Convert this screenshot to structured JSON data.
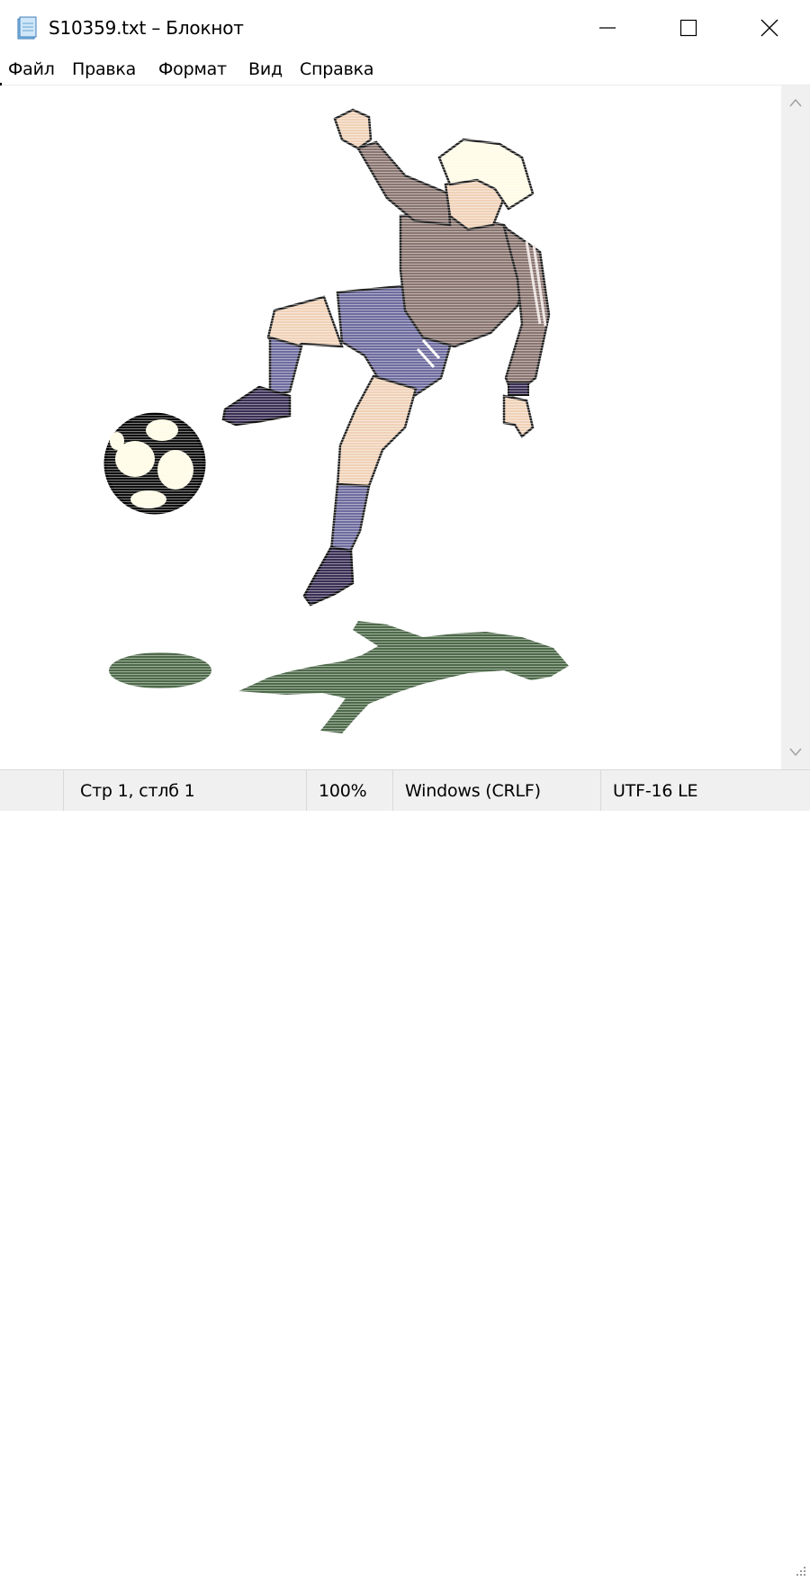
{
  "window": {
    "title": "S10359.txt – Блокнот"
  },
  "menu": {
    "items": [
      "Файл",
      "Правка",
      "Формат",
      "Вид",
      "Справка"
    ]
  },
  "controls": {
    "minimize_icon": "minimize-icon",
    "maximize_icon": "maximize-icon",
    "close_icon": "close-icon"
  },
  "editor": {
    "content_image": "soccer-player-kicking-ball-ascii-art"
  },
  "status": {
    "position": "Стр 1, стлб 1",
    "zoom": "100%",
    "line_ending": "Windows (CRLF)",
    "encoding": "UTF-16 LE"
  },
  "colors": {
    "jersey": "#8a7570",
    "shorts": "#6e6c9e",
    "skin": "#f0d2b8",
    "hair": "#fffbe6",
    "shadow": "#4e6a4a",
    "boots": "#3a2f55"
  }
}
